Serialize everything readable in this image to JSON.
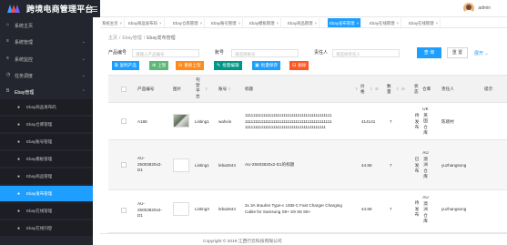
{
  "app": {
    "title": "跨境电商管理平台",
    "user_name": "admin"
  },
  "sidebar": {
    "items": [
      {
        "label": "系统主页",
        "icon": "home-icon"
      },
      {
        "label": "系统管理",
        "icon": "settings-icon"
      },
      {
        "label": "系统监控",
        "icon": "monitor-icon"
      },
      {
        "label": "任务调度",
        "icon": "clock-icon"
      },
      {
        "label": "Ebay管理",
        "icon": "list-icon"
      }
    ],
    "sub_items": [
      {
        "label": "Ebay商品发布码"
      },
      {
        "label": "Ebay仓库管理"
      },
      {
        "label": "Ebay账号管理"
      },
      {
        "label": "Ebay模板管理"
      },
      {
        "label": "Ebay商品管理"
      },
      {
        "label": "Ebay发布管理",
        "active": true
      },
      {
        "label": "Ebay在线管理"
      },
      {
        "label": "Ebay在线刊登"
      }
    ]
  },
  "tabs": [
    {
      "label": "系统主页"
    },
    {
      "label": "Ebay商品发布码"
    },
    {
      "label": "Ebay仓库管理"
    },
    {
      "label": "Ebay账号管理"
    },
    {
      "label": "Ebay模板管理"
    },
    {
      "label": "Ebay商品管理"
    },
    {
      "label": "Ebay发布管理",
      "active": true
    },
    {
      "label": "Ebay在线管理"
    },
    {
      "label": "Ebay在线管理"
    }
  ],
  "breadcrumb": {
    "home": "主页",
    "parent": "Ebay管理",
    "current": "Ebay发布管理"
  },
  "search": {
    "product_label": "产品编号",
    "product_placeholder": "请输入产品编号",
    "account_label": "账号",
    "account_placeholder": "请选择账号",
    "owner_label": "责任人",
    "owner_placeholder": "请选择责任人",
    "query_label": "查 询",
    "reset_label": "重 置",
    "expand_label": "展开"
  },
  "actions": [
    {
      "label": "复制产品",
      "icon": "copy-icon",
      "color": "#1e9fff"
    },
    {
      "label": "上架",
      "icon": "arrow-up-icon",
      "color": "#5fb878"
    },
    {
      "label": "重新上架",
      "icon": "refresh-icon",
      "color": "#ff8a1c"
    },
    {
      "label": "批量编辑",
      "icon": "edit-icon",
      "color": "#009688"
    },
    {
      "label": "批量保存",
      "icon": "save-icon",
      "color": "#1e9fff"
    },
    {
      "label": "删除",
      "icon": "trash-icon",
      "color": "#ff5722"
    }
  ],
  "table": {
    "headers": {
      "product_no": "产品编号",
      "image": "图片",
      "platform_chars": [
        "刊",
        "登",
        "平",
        "台"
      ],
      "account": "账号",
      "title": "标题",
      "price_chars": [
        "价",
        "格"
      ],
      "qty_chars": [
        "数",
        "量"
      ],
      "status_chars": [
        "状",
        "态"
      ],
      "warehouse": "仓库",
      "owner": "责任人",
      "tip": "提示"
    },
    "rows": [
      {
        "product_no": "A186",
        "platform": "Listing1",
        "account": "wahxin",
        "title_lines": [
          "1111111111111111111111111111111111111111111",
          "1111111111111111111111111111111111111111111",
          "1111111111111111111111111111111111111111"
        ],
        "price": "414141",
        "qty": "7",
        "status_chars": [
          "待",
          "发",
          "布"
        ],
        "warehouse_chars": [
          "UK",
          "英",
          "国",
          "仓",
          "库"
        ],
        "owner": "陈晓村"
      },
      {
        "product_no_lines": [
          "AU-",
          "25003820x2-",
          "D1"
        ],
        "platform": "Listing1",
        "account": "leba2644",
        "title_lines": [
          "AU-25003820x2-D1的标题"
        ],
        "price": "44.88",
        "qty": "7",
        "status_chars": [
          "已",
          "发",
          "布"
        ],
        "warehouse_chars": [
          "AU",
          "澳",
          "洲",
          "仓",
          "库"
        ],
        "owner": "yuzhangsong"
      },
      {
        "product_no_lines": [
          "AU-",
          "25003820x2-",
          "D1"
        ],
        "platform": "Listing3",
        "account": "leba2644",
        "title_lines": [
          "2x 3A iKaufen Type-c USB-C Fast Charger Charging",
          "Cable for Samsung S9+ S9 S8 S8+"
        ],
        "price": "44.88",
        "qty": "7",
        "status_chars": [
          "待",
          "发",
          "布"
        ],
        "warehouse_chars": [
          "AU",
          "澳",
          "洲",
          "仓",
          "库"
        ],
        "owner": "yuzhangsong"
      }
    ]
  },
  "footer": {
    "text": "Copyright © 2019 江西行云科技有限公司"
  },
  "colors": {
    "sidebar_bg": "#23262e",
    "accent": "#1e9fff"
  }
}
